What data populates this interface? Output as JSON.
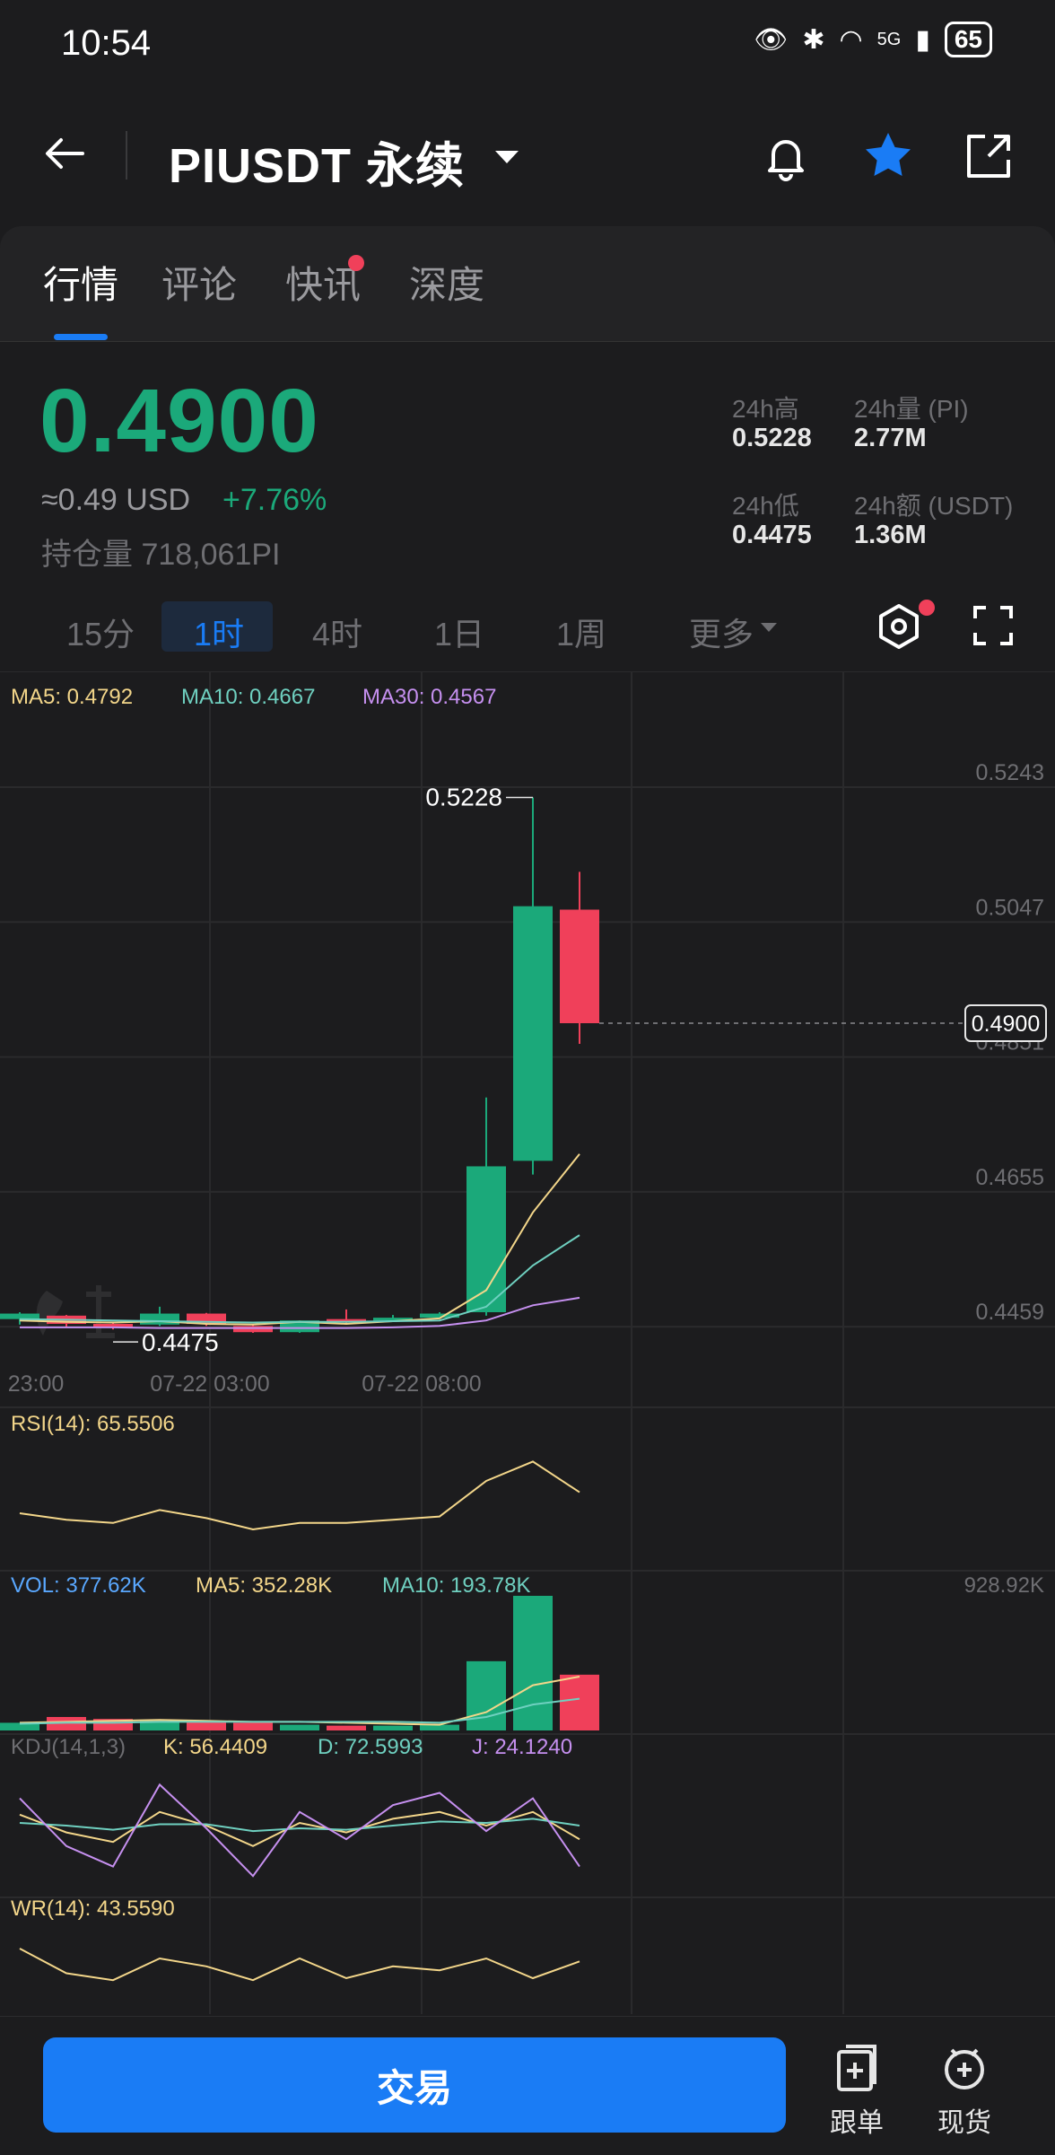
{
  "status_bar": {
    "time": "10:54",
    "network": "5G",
    "battery": "65"
  },
  "header": {
    "title": "PIUSDT 永续"
  },
  "tabs": [
    {
      "label": "行情"
    },
    {
      "label": "评论"
    },
    {
      "label": "快讯"
    },
    {
      "label": "深度"
    }
  ],
  "price": {
    "last": "0.4900",
    "usd": "≈0.49 USD",
    "change": "+7.76%",
    "open_interest": "持仓量 718,061PI"
  },
  "stats": {
    "high_label": "24h高",
    "high_value": "0.5228",
    "vol_label": "24h量 (PI)",
    "vol_value": "2.77M",
    "low_label": "24h低",
    "low_value": "0.4475",
    "amt_label": "24h额 (USDT)",
    "amt_value": "1.36M"
  },
  "intervals": [
    "15分",
    "1时",
    "4时",
    "1日",
    "1周",
    "更多"
  ],
  "chart": {
    "ma_labels": {
      "ma5": "MA5: 0.4792",
      "ma10": "MA10: 0.4667",
      "ma30": "MA30: 0.4567"
    },
    "y_ticks": [
      "0.5243",
      "0.5047",
      "0.4851",
      "0.4655",
      "0.4459"
    ],
    "high_marker": "0.5228",
    "low_marker": "0.4475",
    "last_price_tag": "0.4900",
    "x_ticks": [
      "23:00",
      "07-22 03:00",
      "07-22 08:00"
    ],
    "rsi_label": "RSI(14): 65.5506",
    "vol_labels": {
      "vol": "VOL: 377.62K",
      "ma5": "MA5: 352.28K",
      "ma10": "MA10: 193.78K",
      "max": "928.92K"
    },
    "kdj_labels": {
      "name": "KDJ(14,1,3)",
      "k": "K: 56.4409",
      "d": "D: 72.5993",
      "j": "J: 24.1240"
    },
    "wr_label": "WR(14): 43.5590"
  },
  "chart_data": {
    "type": "candlestick",
    "candles": [
      {
        "o": 0.447,
        "h": 0.448,
        "l": 0.4462,
        "c": 0.4478
      },
      {
        "o": 0.4475,
        "h": 0.4476,
        "l": 0.4458,
        "c": 0.4463
      },
      {
        "o": 0.4463,
        "h": 0.4465,
        "l": 0.4455,
        "c": 0.4458
      },
      {
        "o": 0.4462,
        "h": 0.4488,
        "l": 0.446,
        "c": 0.4478
      },
      {
        "o": 0.4478,
        "h": 0.4479,
        "l": 0.446,
        "c": 0.4463
      },
      {
        "o": 0.446,
        "h": 0.4462,
        "l": 0.445,
        "c": 0.4451
      },
      {
        "o": 0.4451,
        "h": 0.4468,
        "l": 0.445,
        "c": 0.4468
      },
      {
        "o": 0.447,
        "h": 0.4484,
        "l": 0.4463,
        "c": 0.4466
      },
      {
        "o": 0.4468,
        "h": 0.4476,
        "l": 0.4467,
        "c": 0.4472
      },
      {
        "o": 0.4472,
        "h": 0.448,
        "l": 0.4471,
        "c": 0.4478
      },
      {
        "o": 0.448,
        "h": 0.4792,
        "l": 0.4475,
        "c": 0.4692
      },
      {
        "o": 0.47,
        "h": 0.5228,
        "l": 0.468,
        "c": 0.507
      },
      {
        "o": 0.5065,
        "h": 0.512,
        "l": 0.487,
        "c": 0.49
      }
    ],
    "ma5": [
      0.4468,
      0.4466,
      0.4465,
      0.4467,
      0.4463,
      0.4462,
      0.4466,
      0.4463,
      0.4467,
      0.4471,
      0.4512,
      0.4625,
      0.471
    ],
    "ma10": [
      0.447,
      0.4469,
      0.4468,
      0.4467,
      0.4466,
      0.4465,
      0.4466,
      0.4466,
      0.4467,
      0.4468,
      0.4488,
      0.4548,
      0.4592
    ],
    "ma30": [
      0.4458,
      0.4458,
      0.4458,
      0.4457,
      0.4457,
      0.4457,
      0.4457,
      0.4457,
      0.4458,
      0.446,
      0.4468,
      0.449,
      0.4501
    ],
    "rsi": [
      40,
      36,
      34,
      42,
      37,
      30,
      34,
      34,
      36,
      38,
      60,
      72,
      53
    ],
    "volume": [
      8,
      14,
      12,
      10,
      9,
      8,
      6,
      5,
      5,
      6,
      72,
      140,
      58
    ],
    "vol_ma5": [
      8,
      9,
      10,
      11,
      10,
      9,
      9,
      8,
      7,
      6,
      19,
      47,
      56
    ],
    "vol_ma10": [
      7,
      8,
      8,
      9,
      9,
      9,
      9,
      9,
      9,
      8,
      14,
      27,
      33
    ],
    "kdj_k": [
      58,
      45,
      38,
      60,
      50,
      35,
      52,
      45,
      55,
      60,
      50,
      60,
      40
    ],
    "kdj_d": [
      52,
      50,
      47,
      51,
      51,
      46,
      48,
      47,
      50,
      53,
      52,
      55,
      50
    ],
    "kdj_j": [
      70,
      35,
      20,
      80,
      48,
      13,
      60,
      40,
      65,
      74,
      46,
      70,
      20
    ],
    "wr": [
      30,
      55,
      62,
      40,
      48,
      62,
      40,
      60,
      48,
      52,
      40,
      60,
      43
    ]
  },
  "bottom_bar": {
    "trade_label": "交易",
    "copy_label": "跟单",
    "spot_label": "现货"
  },
  "colors": {
    "up": "#1ba97a",
    "down": "#f0405a",
    "accent": "#1a7cf5"
  }
}
